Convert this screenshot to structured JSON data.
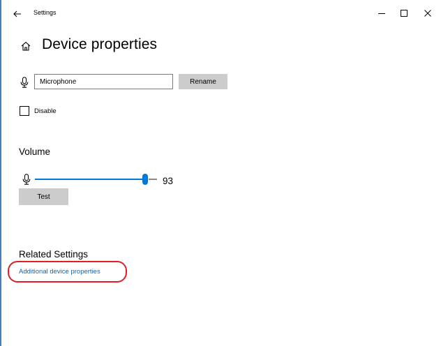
{
  "window": {
    "title": "Settings",
    "controls": {
      "minimize": "–",
      "maximize": "☐",
      "close": "✕"
    }
  },
  "page": {
    "title": "Device properties"
  },
  "device": {
    "name_value": "Microphone",
    "rename_label": "Rename",
    "disable_label": "Disable",
    "disable_checked": false
  },
  "volume": {
    "heading": "Volume",
    "level": 93,
    "level_text": "93",
    "test_label": "Test"
  },
  "related": {
    "heading": "Related Settings",
    "link_label": "Additional device properties"
  },
  "icons": [
    "back-arrow-icon",
    "home-icon",
    "microphone-icon",
    "minimize-icon",
    "maximize-icon",
    "close-icon"
  ],
  "colors": {
    "accent": "#0078d7",
    "link": "#0067c0",
    "highlight": "#e01e26",
    "button_bg": "#cccccc"
  }
}
